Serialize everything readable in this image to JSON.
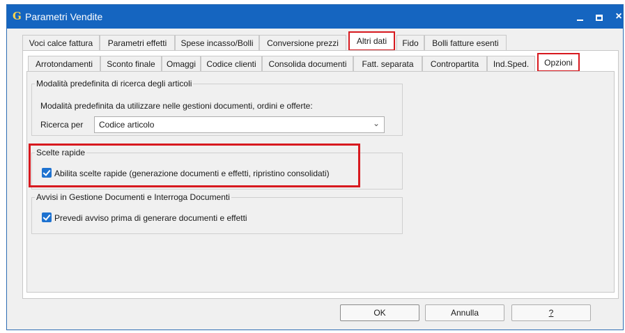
{
  "window": {
    "logo": "G",
    "title": "Parametri Vendite",
    "controls": {
      "minimize": "minimize",
      "maximize": "maximize",
      "close": "×"
    }
  },
  "tabs_top": [
    "Voci calce fattura",
    "Parametri effetti",
    "Spese incasso/Bolli",
    "Conversione prezzi",
    "Altri dati",
    "Fido",
    "Bolli fatture esenti"
  ],
  "tabs_top_selected": "Altri dati",
  "tabs_sub": [
    "Arrotondamenti",
    "Sconto finale",
    "Omaggi",
    "Codice clienti",
    "Consolida documenti",
    "Fatt. separata",
    "Contropartita",
    "Ind.Sped.",
    "Opzioni"
  ],
  "tabs_sub_selected": "Opzioni",
  "group_ricerca": {
    "title": "Modalità predefinita di ricerca degli articoli",
    "description": "Modalità predefinita da utilizzare nelle gestioni documenti, ordini e offerte:",
    "ricerca_label": "Ricerca per",
    "ricerca_value": "Codice articolo"
  },
  "group_scelte": {
    "title": "Scelte rapide",
    "checkbox_label": "Abilita scelte rapide (generazione documenti e effetti, ripristino consolidati)",
    "checked": true
  },
  "group_avvisi": {
    "title": "Avvisi in Gestione Documenti e Interroga Documenti",
    "checkbox_label": "Prevedi avviso prima di generare documenti e effetti",
    "checked": true
  },
  "buttons": {
    "ok": "OK",
    "annulla": "Annulla",
    "help": "?"
  },
  "colors": {
    "titlebar": "#1565c0",
    "highlight": "#d7191f",
    "checkbox": "#1e72d0"
  }
}
